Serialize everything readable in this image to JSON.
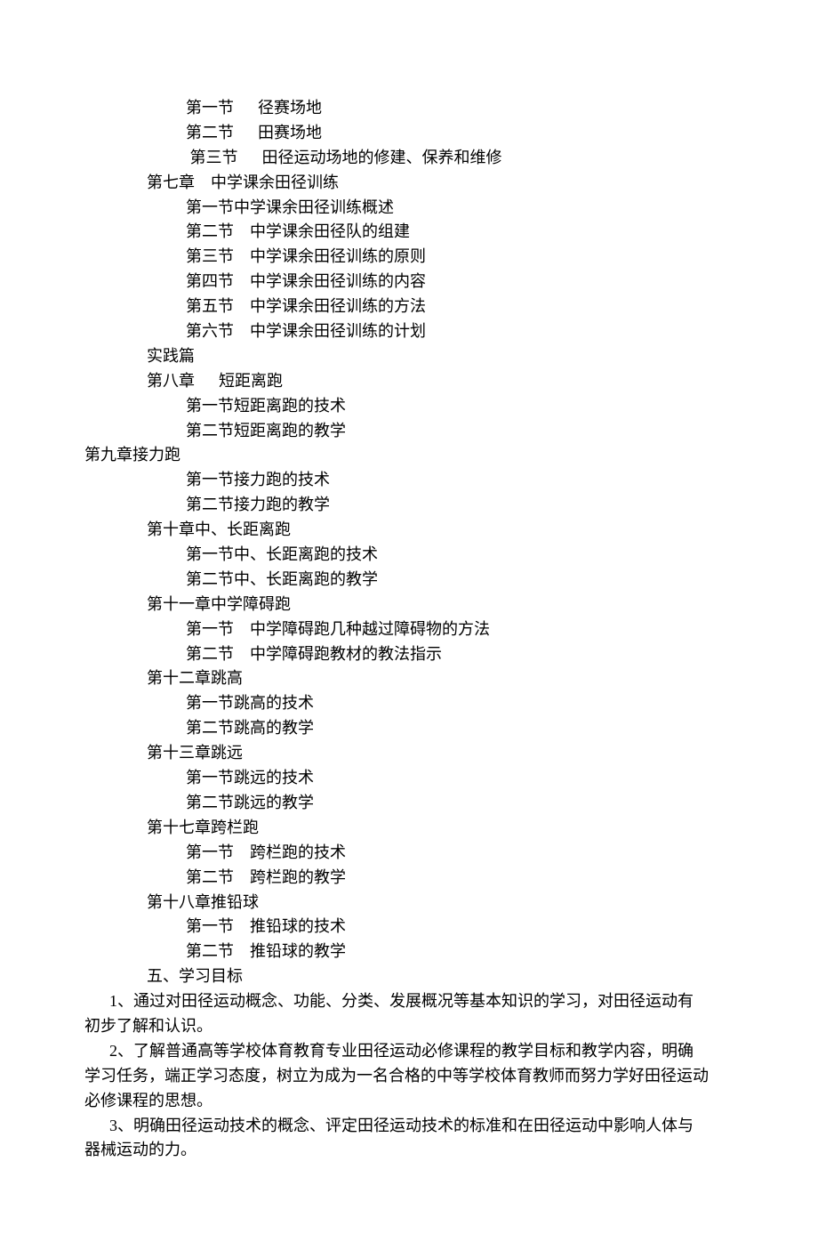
{
  "lines": [
    {
      "indent": 3,
      "text": "第一节      径赛场地"
    },
    {
      "indent": 3,
      "text": "第二节      田赛场地"
    },
    {
      "indent": 3,
      "text": " 第三节      田径运动场地的修建、保养和维修"
    },
    {
      "indent": 2,
      "text": "第七章    中学课余田径训练"
    },
    {
      "indent": 3,
      "text": "第一节中学课余田径训练概述"
    },
    {
      "indent": 3,
      "text": "第二节    中学课余田径队的组建"
    },
    {
      "indent": 3,
      "text": "第三节    中学课余田径训练的原则"
    },
    {
      "indent": 3,
      "text": "第四节    中学课余田径训练的内容"
    },
    {
      "indent": 3,
      "text": "第五节    中学课余田径训练的方法"
    },
    {
      "indent": 3,
      "text": "第六节    中学课余田径训练的计划"
    },
    {
      "indent": 2,
      "text": "实践篇"
    },
    {
      "indent": 2,
      "text": "第八章      短距离跑"
    },
    {
      "indent": 3,
      "text": "第一节短距离跑的技术"
    },
    {
      "indent": 3,
      "text": "第二节短距离跑的教学"
    },
    {
      "indent": 0,
      "text": "第九章接力跑"
    },
    {
      "indent": 3,
      "text": "第一节接力跑的技术"
    },
    {
      "indent": 3,
      "text": "第二节接力跑的教学"
    },
    {
      "indent": 2,
      "text": "第十章中、长距离跑"
    },
    {
      "indent": 3,
      "text": "第一节中、长距离跑的技术"
    },
    {
      "indent": 3,
      "text": "第二节中、长距离跑的教学"
    },
    {
      "indent": 2,
      "text": "第十一章中学障碍跑"
    },
    {
      "indent": 3,
      "text": "第一节    中学障碍跑几种越过障碍物的方法"
    },
    {
      "indent": 3,
      "text": "第二节    中学障碍跑教材的教法指示"
    },
    {
      "indent": 2,
      "text": "第十二章跳高"
    },
    {
      "indent": 3,
      "text": "第一节跳高的技术"
    },
    {
      "indent": 3,
      "text": "第二节跳高的教学"
    },
    {
      "indent": 2,
      "text": "第十三章跳远"
    },
    {
      "indent": 3,
      "text": "第一节跳远的技术"
    },
    {
      "indent": 3,
      "text": "第二节跳远的教学"
    },
    {
      "indent": 2,
      "text": "第十七章跨栏跑"
    },
    {
      "indent": 3,
      "text": "第一节    跨栏跑的技术"
    },
    {
      "indent": 3,
      "text": "第二节    跨栏跑的教学"
    },
    {
      "indent": 2,
      "text": "第十八章推铅球"
    },
    {
      "indent": 3,
      "text": "第一节    推铅球的技术"
    },
    {
      "indent": 3,
      "text": "第二节    推铅球的教学"
    },
    {
      "indent": 2,
      "text": "五、学习目标"
    },
    {
      "indent": 1,
      "text": "1、通过对田径运动概念、功能、分类、发展概况等基本知识的学习，对田径运动有"
    },
    {
      "indent": 0,
      "text": "初步了解和认识。"
    },
    {
      "indent": 1,
      "text": "2、了解普通高等学校体育教育专业田径运动必修课程的教学目标和教学内容，明确"
    },
    {
      "indent": 0,
      "text": "学习任务，端正学习态度，树立为成为一名合格的中等学校体育教师而努力学好田径运动"
    },
    {
      "indent": 0,
      "text": "必修课程的思想。"
    },
    {
      "indent": 1,
      "text": "3、明确田径运动技术的概念、评定田径运动技术的标准和在田径运动中影响人体与"
    },
    {
      "indent": 0,
      "text": "器械运动的力。"
    }
  ]
}
